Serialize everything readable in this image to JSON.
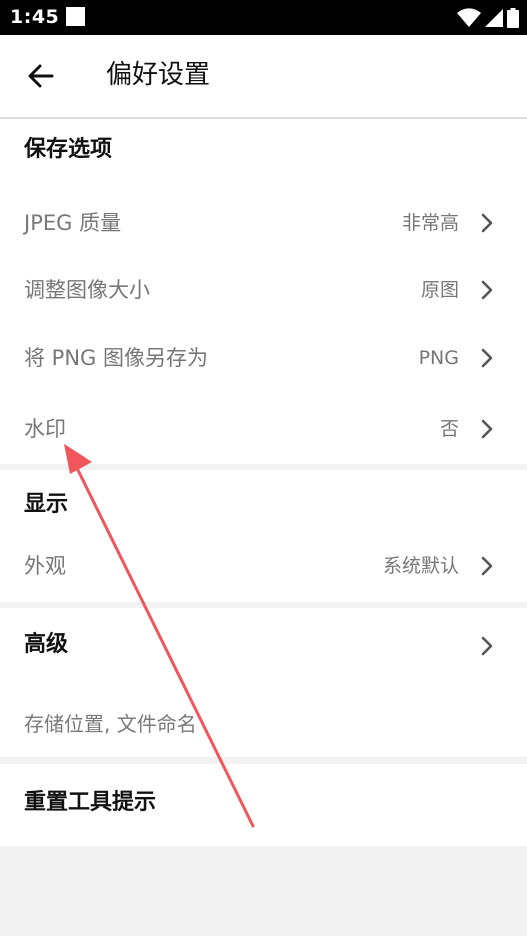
{
  "status_bar": {
    "time": "1:45",
    "icons": [
      "notification-square-icon",
      "wifi-icon",
      "cellular-signal-icon",
      "battery-icon"
    ]
  },
  "app_bar": {
    "title": "偏好设置",
    "back_icon": "back-arrow-icon"
  },
  "save_options": {
    "title": "保存选项",
    "items": [
      {
        "label": "JPEG 质量",
        "value": "非常高"
      },
      {
        "label": "调整图像大小",
        "value": "原图"
      },
      {
        "label": "将 PNG 图像另存为",
        "value": "PNG"
      },
      {
        "label": "水印",
        "value": "否"
      }
    ]
  },
  "display": {
    "title": "显示",
    "items": [
      {
        "label": "外观",
        "value": "系统默认"
      }
    ]
  },
  "advanced": {
    "title": "高级",
    "subtitle": "存储位置, 文件命名"
  },
  "reset_tooltips": {
    "title": "重置工具提示"
  },
  "colors": {
    "annotation_arrow": "#f0565c",
    "section_gap": "#f2f2f2",
    "status_bar": "#000000"
  }
}
